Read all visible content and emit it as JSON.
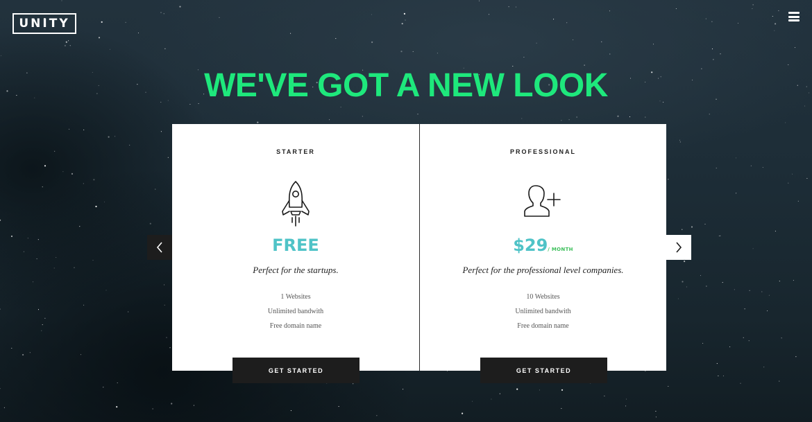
{
  "header": {
    "logo_text": "UNITY",
    "menu_icon": "hamburger-icon"
  },
  "hero": {
    "headline": "WE'VE GOT A NEW LOOK"
  },
  "carousel": {
    "prev_icon": "chevron-left-icon",
    "next_icon": "chevron-right-icon"
  },
  "plans": [
    {
      "name": "STARTER",
      "icon": "rocket-icon",
      "price": "FREE",
      "per": "",
      "tagline": "Perfect for the startups.",
      "features": [
        "1 Websites",
        "Unlimited bandwith",
        "Free domain name"
      ],
      "cta": "GET STARTED"
    },
    {
      "name": "PROFESSIONAL",
      "icon": "add-user-icon",
      "price": "$29",
      "per": "/ MONTH",
      "tagline": "Perfect for the professional level companies.",
      "features": [
        "10 Websites",
        "Unlimited bandwith",
        "Free domain name"
      ],
      "cta": "GET STARTED"
    }
  ],
  "colors": {
    "headline": "#1ee87c",
    "price_free": "#4fc3c7",
    "price_per": "#3ec05c",
    "button_bg": "#1d1d1d"
  }
}
